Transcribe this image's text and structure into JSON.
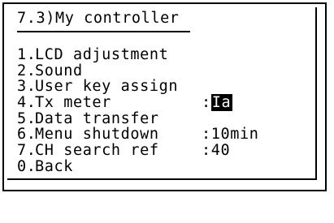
{
  "screen": {
    "title": "7.3)My controller",
    "items": [
      {
        "num": "1.",
        "label": "LCD adjustment",
        "value_prefix": "",
        "value": ""
      },
      {
        "num": "2.",
        "label": "Sound",
        "value_prefix": "",
        "value": ""
      },
      {
        "num": "3.",
        "label": "User key assign",
        "value_prefix": "",
        "value": ""
      },
      {
        "num": "4.",
        "label": "Tx meter",
        "value_prefix": ":",
        "value": "Ia"
      },
      {
        "num": "5.",
        "label": "Data transfer",
        "value_prefix": "",
        "value": ""
      },
      {
        "num": "6.",
        "label": "Menu shutdown",
        "value_prefix": ":",
        "value": "10min"
      },
      {
        "num": "7.",
        "label": "CH search ref",
        "value_prefix": ":",
        "value": "40"
      },
      {
        "num": "0.",
        "label": "Back",
        "value_prefix": "",
        "value": ""
      }
    ]
  }
}
